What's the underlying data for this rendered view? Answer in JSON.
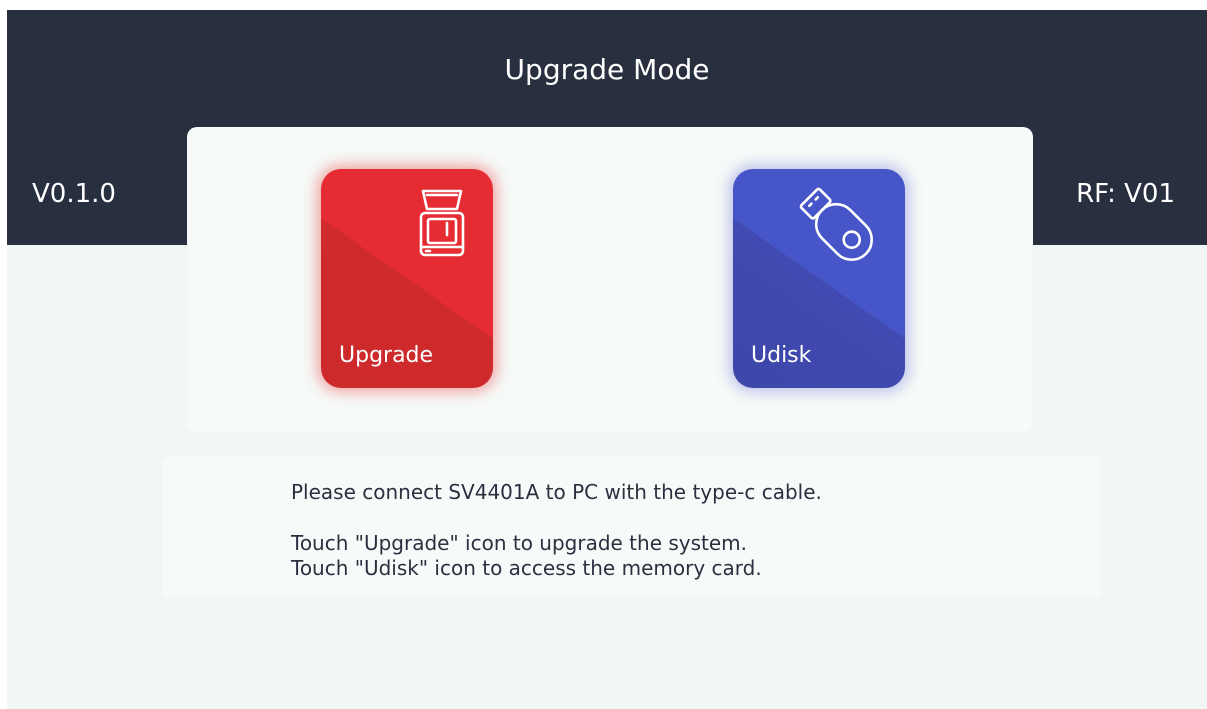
{
  "header": {
    "title": "Upgrade Mode",
    "version": "V0.1.0",
    "rf_version": "RF: V01"
  },
  "tiles": [
    {
      "label": "Upgrade",
      "icon": "scanner-icon",
      "color": "#e42c32"
    },
    {
      "label": "Udisk",
      "icon": "usb-drive-icon",
      "color": "#4655c7"
    }
  ],
  "instructions": {
    "line1": "Please connect SV4401A to PC with the type-c cable.",
    "line2": "Touch \"Upgrade\" icon to upgrade the system.",
    "line3": "Touch \"Udisk\" icon to access the memory card."
  },
  "colors": {
    "header_bg": "#283040",
    "screen_bg": "#f1f7f5",
    "upgrade_accent": "#e42c32",
    "udisk_accent": "#4655c7"
  }
}
